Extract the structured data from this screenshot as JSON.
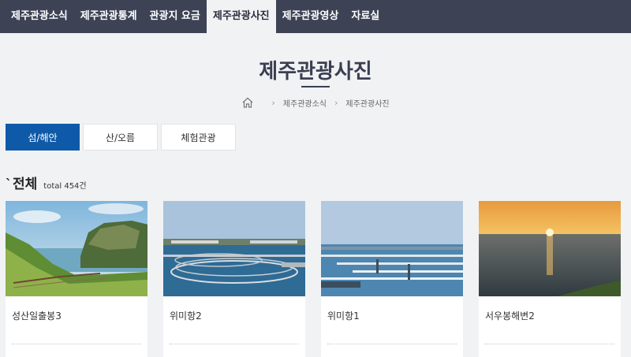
{
  "nav": {
    "items": [
      {
        "label": "제주관광소식",
        "active": false
      },
      {
        "label": "제주관광통계",
        "active": false
      },
      {
        "label": "관광지 요금",
        "active": false
      },
      {
        "label": "제주관광사진",
        "active": true
      },
      {
        "label": "제주관광영상",
        "active": false
      },
      {
        "label": "자료실",
        "active": false
      }
    ]
  },
  "page": {
    "title": "제주관광사진"
  },
  "breadcrumb": {
    "home_icon": "home-icon",
    "items": [
      "제주관광소식",
      "제주관광사진"
    ]
  },
  "tabs": [
    {
      "label": "섬/해안",
      "active": true
    },
    {
      "label": "산/오름",
      "active": false
    },
    {
      "label": "체험관광",
      "active": false
    }
  ],
  "section": {
    "tick": "`",
    "title": "전체",
    "count": "total 454건"
  },
  "photos": [
    {
      "title": "성산일출봉3",
      "scene": "coastal-cliff"
    },
    {
      "title": "위미항2",
      "scene": "fish-farm-pens"
    },
    {
      "title": "위미항1",
      "scene": "harbor-piers"
    },
    {
      "title": "서우봉해변2",
      "scene": "sunset-sea"
    }
  ],
  "colors": {
    "nav_bg": "#3d4255",
    "active_tab": "#0f5aa8",
    "page_bg": "#f1f2f4"
  }
}
